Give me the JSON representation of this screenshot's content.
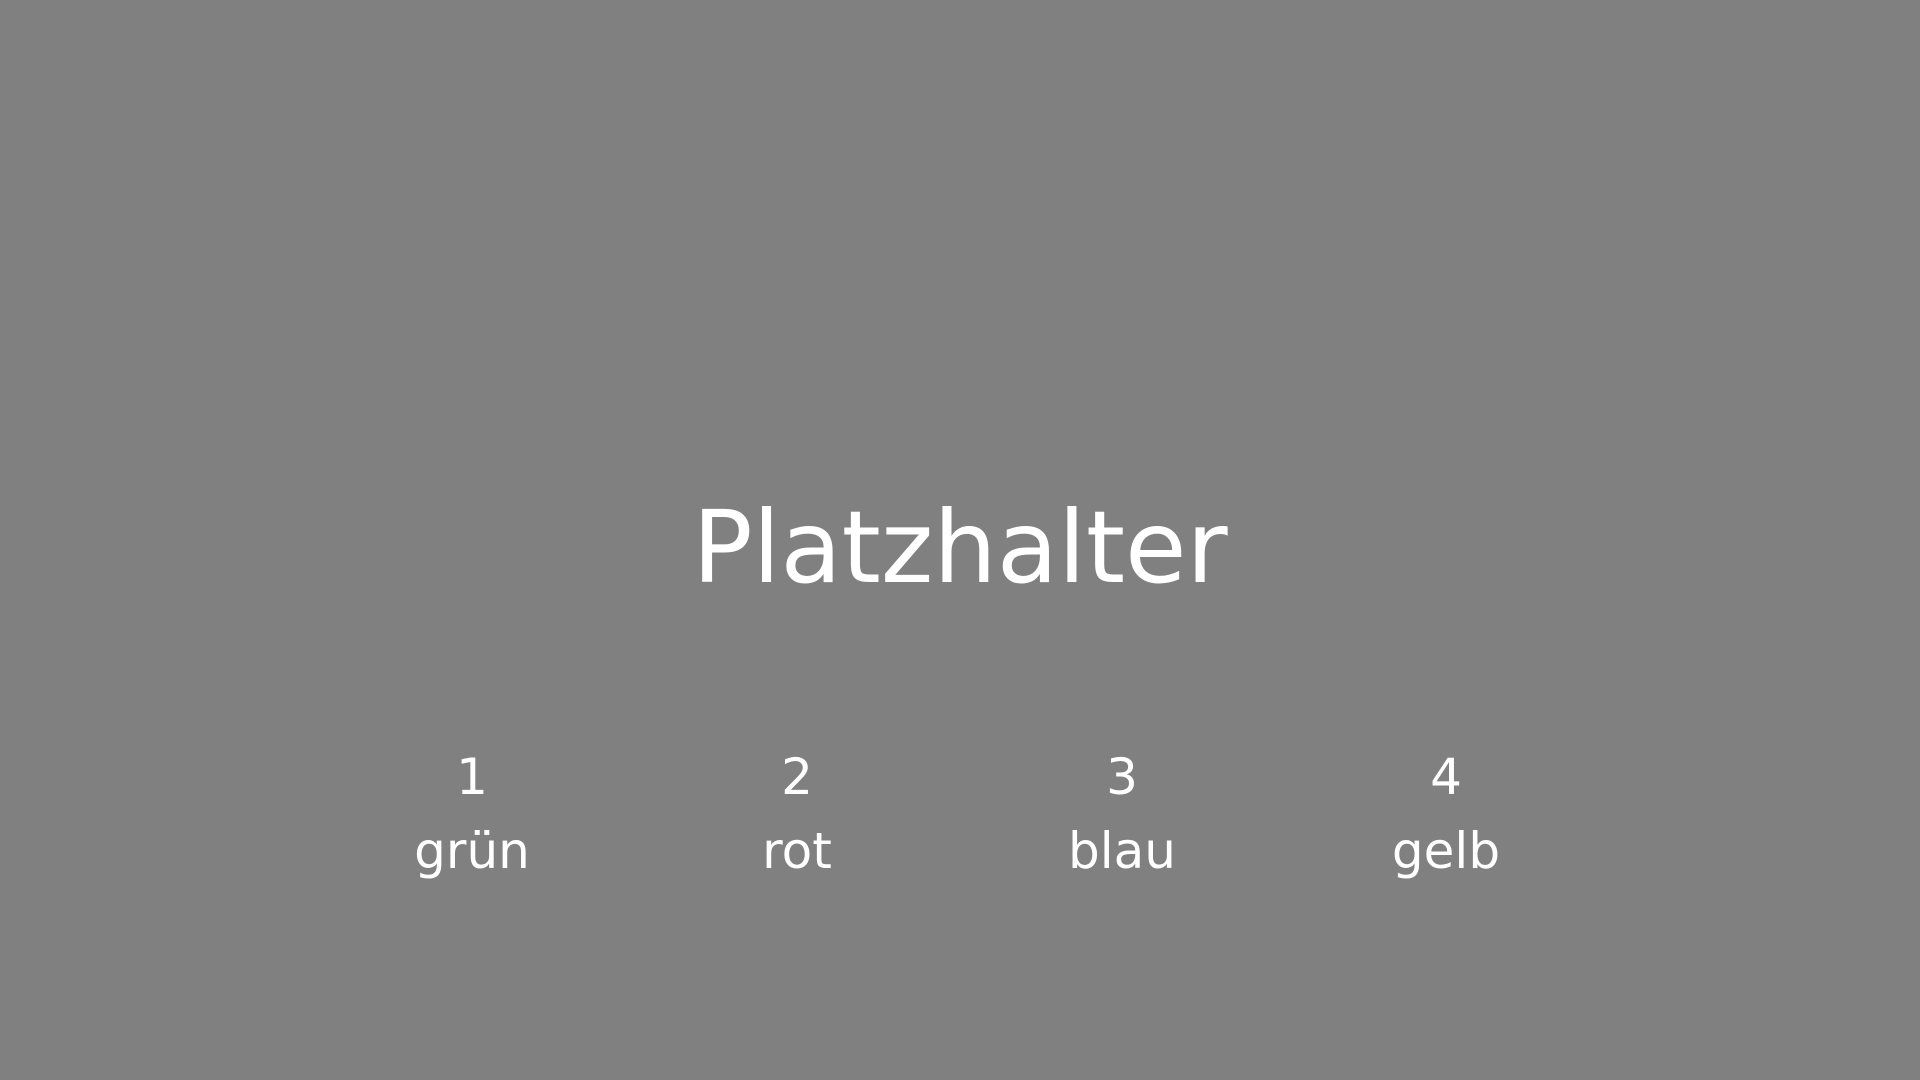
{
  "colors": {
    "background": "#808080",
    "text": "#ffffff"
  },
  "title": "Platzhalter",
  "options": [
    {
      "number": "1",
      "label": "grün"
    },
    {
      "number": "2",
      "label": "rot"
    },
    {
      "number": "3",
      "label": "blau"
    },
    {
      "number": "4",
      "label": "gelb"
    }
  ]
}
